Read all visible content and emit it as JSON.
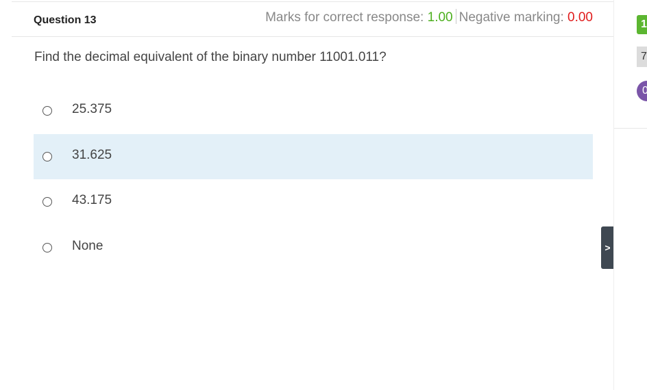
{
  "question": {
    "title": "Question 13",
    "marks_label": "Marks for correct response:",
    "marks_value": "1.00",
    "negative_label": "Negative marking:",
    "negative_value": "0.00",
    "text": "Find the decimal equivalent of the binary number 11001.011?"
  },
  "options": [
    {
      "label": "25.375"
    },
    {
      "label": "31.625"
    },
    {
      "label": "43.175"
    },
    {
      "label": "None"
    }
  ],
  "right_panel": {
    "badge_green": "1",
    "badge_grey": "7",
    "badge_purple": "0",
    "toggle_label": ">"
  },
  "colors": {
    "positive": "#4caf1e",
    "negative": "#e01b1b",
    "highlight": "#e3f0f8",
    "toggle_bg": "#3f4852"
  }
}
